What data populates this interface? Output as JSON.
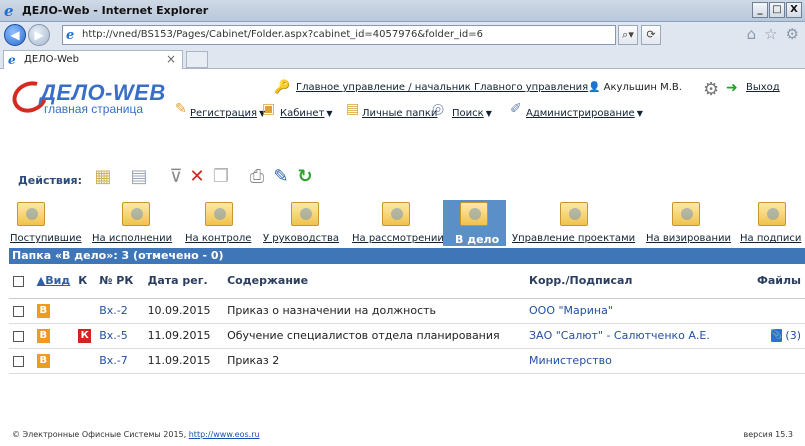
{
  "window": {
    "title": "ДЕЛО-Web - Internet Explorer",
    "buttons": [
      "_",
      "□",
      "X"
    ]
  },
  "browser": {
    "url": "http://vned/BS153/Pages/Cabinet/Folder.aspx?cabinet_id=4057976&folder_id=6",
    "tab_label": "ДЕЛО-Web"
  },
  "logo": {
    "brand": "ДЕЛО-WEB",
    "subtitle": "главная страница"
  },
  "header": {
    "org_link": "Главное управление / начальник Главного управления",
    "user": "Акульшин М.В.",
    "exit": "Выход"
  },
  "menu": [
    {
      "label": "Регистрация",
      "has_dropdown": true
    },
    {
      "label": "Кабинет",
      "has_dropdown": true
    },
    {
      "label": "Личные папки",
      "has_dropdown": false
    },
    {
      "label": "Поиск",
      "has_dropdown": true
    },
    {
      "label": "Администрирование",
      "has_dropdown": true
    }
  ],
  "actions": {
    "label": "Действия:"
  },
  "folders": [
    {
      "label": "Поступившие",
      "active": false
    },
    {
      "label": "На исполнении",
      "active": false
    },
    {
      "label": "На контроле",
      "active": false
    },
    {
      "label": "У руководства",
      "active": false
    },
    {
      "label": "На рассмотрении",
      "active": false
    },
    {
      "label": "В дело",
      "active": true
    },
    {
      "label": "Управление проектами",
      "active": false
    },
    {
      "label": "На визировании",
      "active": false
    },
    {
      "label": "На подписи",
      "active": false
    }
  ],
  "folder_header": "Папка «В дело»: 3 (отмечено - 0)",
  "table": {
    "columns": [
      "▲Вид",
      "К",
      "№ РК",
      "Дата рег.",
      "Содержание",
      "Корр./Подписал",
      "Файлы"
    ],
    "rows": [
      {
        "vid": "В",
        "k": "",
        "num": "Вх.-2",
        "date": "10.09.2015",
        "content": "Приказ о назначении на должность",
        "corr": "ООО \"Марина\"",
        "files": ""
      },
      {
        "vid": "В",
        "k": "К",
        "num": "Вх.-5",
        "date": "11.09.2015",
        "content": "Обучение специалистов отдела планирования",
        "corr": "ЗАО \"Салют\" - Салютченко А.Е.",
        "files": "(3)"
      },
      {
        "vid": "В",
        "k": "",
        "num": "Вх.-7",
        "date": "11.09.2015",
        "content": "Приказ 2",
        "corr": "Министерство",
        "files": ""
      }
    ]
  },
  "footer": {
    "text": "© Электронные Офисные Системы 2015,",
    "link": "http://www.eos.ru",
    "version": "версия 15.3"
  },
  "colors": {
    "accent": "#3f76b8",
    "badge_v": "#f19a1f",
    "badge_k": "#d7231f"
  }
}
